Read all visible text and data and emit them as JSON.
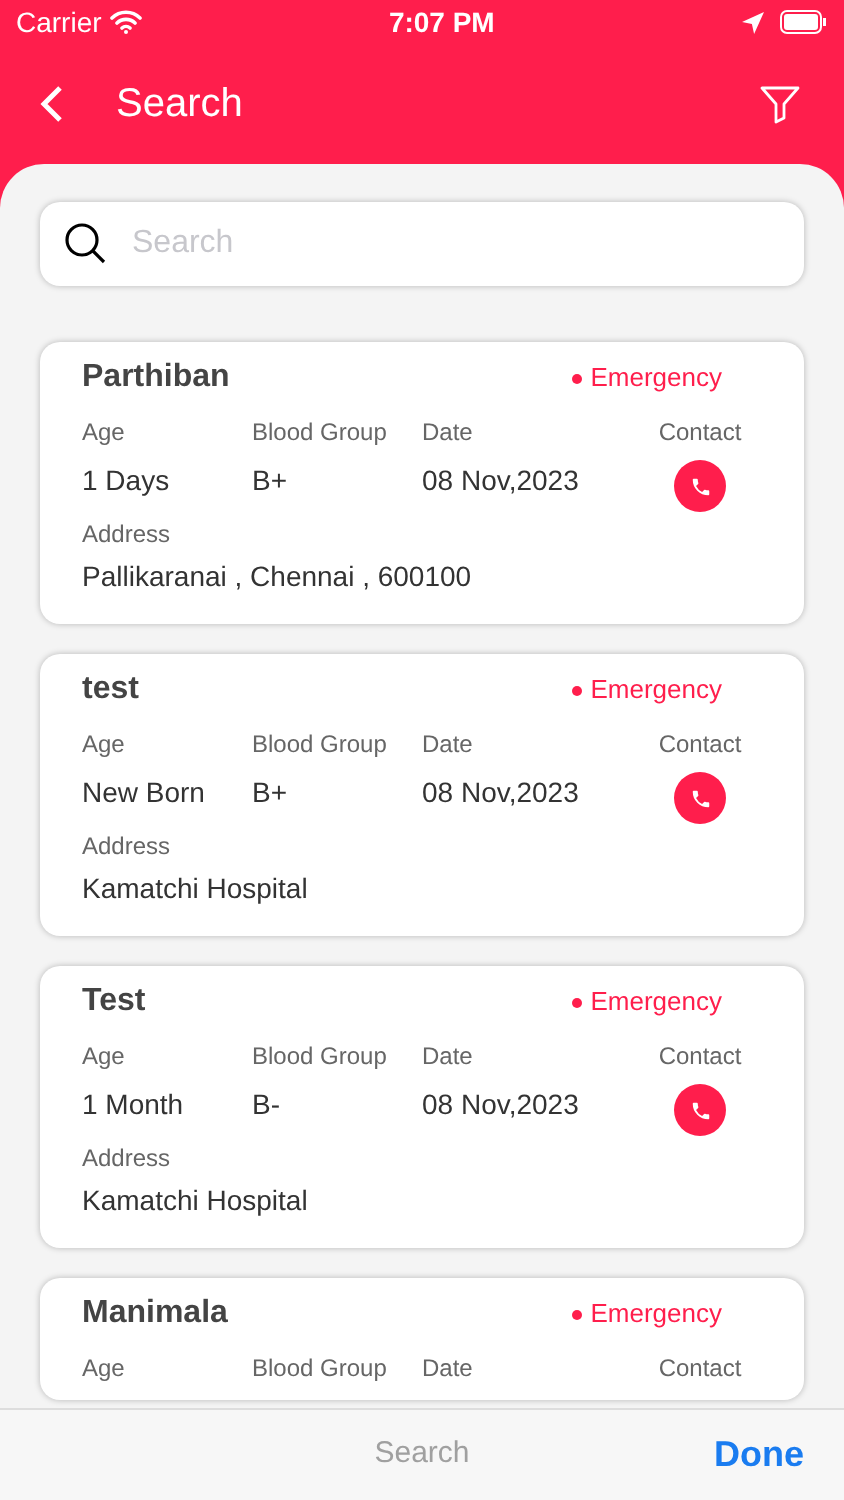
{
  "status_bar": {
    "carrier": "Carrier",
    "time": "7:07 PM"
  },
  "header": {
    "title": "Search"
  },
  "search": {
    "placeholder": "Search"
  },
  "cards": [
    {
      "name": "Parthiban",
      "status": "Emergency",
      "labels": [
        "Age",
        "Blood Group",
        "Date",
        "Contact"
      ],
      "values": [
        "1 Days",
        "B+",
        "08 Nov,2023"
      ],
      "address_label": "Address",
      "address": "Pallikaranai , Chennai , 600100"
    },
    {
      "name": "test",
      "status": "Emergency",
      "labels": [
        "Age",
        "Blood Group",
        "Date",
        "Contact"
      ],
      "values": [
        "New Born",
        "B+",
        "08 Nov,2023"
      ],
      "address_label": "Address",
      "address": "Kamatchi Hospital"
    },
    {
      "name": "Test",
      "status": "Emergency",
      "labels": [
        "Age",
        "Blood Group",
        "Date",
        "Contact"
      ],
      "values": [
        "1 Month",
        "B-",
        "08 Nov,2023"
      ],
      "address_label": "Address",
      "address": "Kamatchi Hospital"
    },
    {
      "name": "Manimala",
      "status": "Emergency",
      "labels": [
        "Age",
        "Blood Group",
        "Date",
        "Contact"
      ]
    }
  ],
  "keyboard_toolbar": {
    "title": "Search",
    "done": "Done"
  }
}
